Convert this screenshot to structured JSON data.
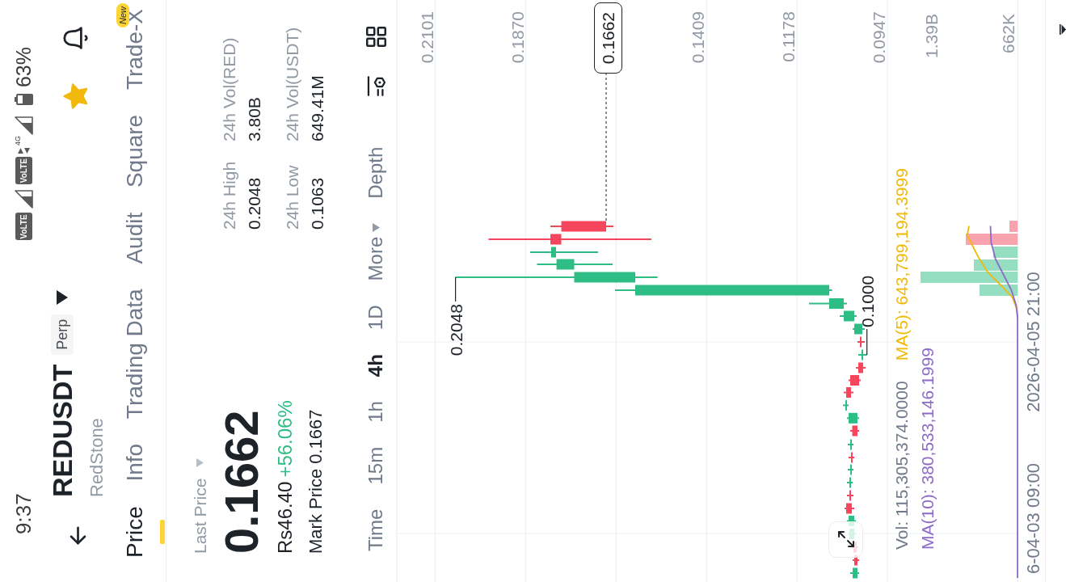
{
  "status_bar": {
    "time": "9:37",
    "sims": [
      {
        "badge": "VoLTE"
      },
      {
        "badge": "VoLTE",
        "network": "4G"
      }
    ],
    "battery": "63%"
  },
  "header": {
    "symbol": "REDUSDT",
    "badge": "Perp",
    "name": "RedStone",
    "favorite": true
  },
  "tabs": [
    {
      "label": "Price",
      "selected": true
    },
    {
      "label": "Info",
      "selected": false
    },
    {
      "label": "Trading Data",
      "selected": false
    },
    {
      "label": "Audit",
      "selected": false
    },
    {
      "label": "Square",
      "selected": false
    },
    {
      "label": "Trade-X",
      "selected": false,
      "badge": "New"
    }
  ],
  "price_panel": {
    "selector": "Last Price",
    "last_price": "0.1662",
    "fiat_price": "Rs46.40",
    "change": "+56.06%",
    "mark_price": "Mark Price 0.1667",
    "stats": [
      {
        "label": "24h High",
        "value": "0.2048"
      },
      {
        "label": "24h Vol(RED)",
        "value": "3.80B"
      },
      {
        "label": "24h Low",
        "value": "0.1063"
      },
      {
        "label": "24h Vol(USDT)",
        "value": "649.41M"
      }
    ]
  },
  "intervals": [
    {
      "label": "Time",
      "kind": "option",
      "selected": false
    },
    {
      "label": "15m",
      "kind": "option",
      "selected": false
    },
    {
      "label": "1h",
      "kind": "option",
      "selected": false
    },
    {
      "label": "4h",
      "kind": "option",
      "selected": true
    },
    {
      "label": "1D",
      "kind": "option",
      "selected": false
    },
    {
      "label": "More",
      "kind": "menu",
      "selected": false
    },
    {
      "label": "Depth",
      "kind": "option",
      "selected": false
    }
  ],
  "chart": {
    "price_axis": [
      "0.2101",
      "0.1870",
      "0.1409",
      "0.1178",
      "0.0947"
    ],
    "last_price_tag": "0.1662",
    "high_marker": "0.2048",
    "low_marker": "0.1000",
    "volume_legend": [
      {
        "text": "Vol: 115,305,374.0000"
      },
      {
        "text": "MA(5): 643,799,194.3999",
        "color": "#f0b90b"
      },
      {
        "text": "MA(10): 380,533,146.1999",
        "color": "#8d6cc8"
      }
    ],
    "volume_axis": [
      "1.39B",
      "662K"
    ],
    "time_axis": [
      "6-04-03 09:00",
      "2026-04-05 21:00"
    ]
  }
}
